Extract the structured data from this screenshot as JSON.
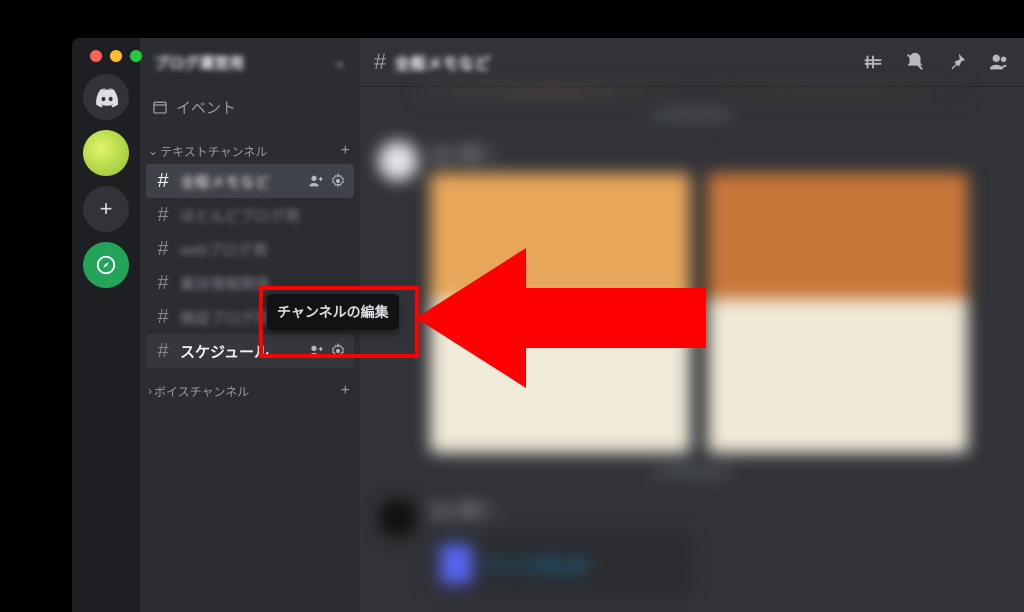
{
  "server_name": "ブログ運営用",
  "events_label": "イベント",
  "categories": {
    "text": {
      "label": "テキストチャンネル"
    },
    "voice": {
      "label": "ボイスチャンネル"
    }
  },
  "channels": [
    {
      "label": "全般メモなど",
      "selected": true
    },
    {
      "label": "ほとんどブログ用"
    },
    {
      "label": "webブログ用"
    },
    {
      "label": "裏技情報関係"
    },
    {
      "label": "検証ブログ用"
    },
    {
      "label": "スケジュール",
      "clear": true
    }
  ],
  "current_channel": "全般メモなど",
  "tooltip": "チャンネルの編集",
  "date_divider": "2023年9月5日",
  "colors": {
    "red": "#ff0000",
    "discord_bg": "#313338"
  }
}
